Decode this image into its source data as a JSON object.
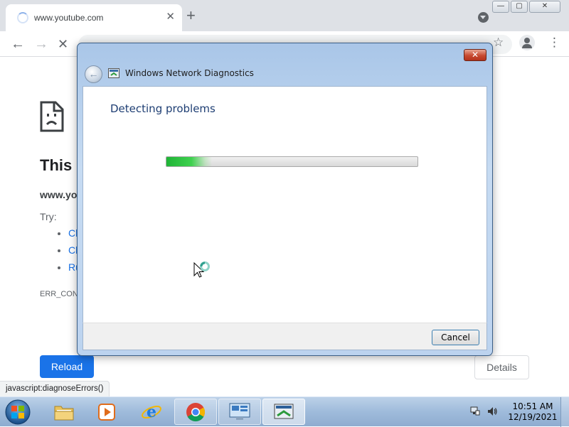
{
  "browser": {
    "tab_title": "www.youtube.com",
    "tab_close": "✕",
    "new_tab": "+",
    "minimize": "—",
    "maximize": "▢",
    "close": "✕"
  },
  "error_page": {
    "title_fragment": "This s",
    "host_fragment": "www.yo",
    "try_label": "Try:",
    "suggestions": [
      "Cl",
      "Cl",
      "Ru"
    ],
    "error_code_fragment": "ERR_CON",
    "reload_label": "Reload",
    "details_label": "Details"
  },
  "status_bar": {
    "text": "javascript:diagnoseErrors()"
  },
  "dialog": {
    "title": "Windows Network Diagnostics",
    "heading": "Detecting problems",
    "close_glyph": "✕",
    "cancel_label": "Cancel",
    "progress": 0.18
  },
  "taskbar": {
    "items": [
      "start",
      "file-explorer",
      "media-player",
      "internet-explorer",
      "chrome",
      "remote-desktop",
      "network-diagnostics"
    ],
    "clock_time": "10:51 AM",
    "clock_date": "12/19/2021"
  }
}
